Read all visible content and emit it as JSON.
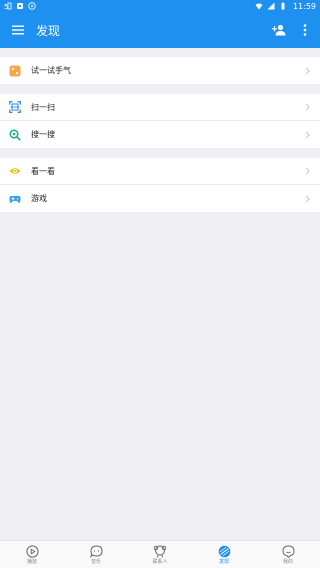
{
  "status_bar": {
    "left_icons": [
      "qq-notification-icon",
      "image-notification-icon",
      "play-notification-icon"
    ],
    "right_icons": [
      "wifi-icon",
      "signal-icon",
      "battery-icon"
    ],
    "time": "11:59"
  },
  "app_bar": {
    "title": "发现",
    "actions": [
      "add-contact-icon",
      "more-vertical-icon"
    ]
  },
  "groups": [
    {
      "items": [
        {
          "label": "试一试手气",
          "icon": "dice-icon",
          "color": "#f4a84a"
        }
      ]
    },
    {
      "items": [
        {
          "label": "扫一扫",
          "icon": "scan-icon",
          "color": "#3a8ee6"
        },
        {
          "label": "搜一搜",
          "icon": "search-icon",
          "color": "#19b28a"
        }
      ]
    },
    {
      "items": [
        {
          "label": "看一看",
          "icon": "eye-icon",
          "color": "#f2c200"
        },
        {
          "label": "游戏",
          "icon": "gamepad-icon",
          "color": "#3aa0e6"
        }
      ]
    }
  ],
  "bottom_nav": [
    {
      "label": "播放",
      "icon": "play-circle-icon",
      "active": false
    },
    {
      "label": "音乐",
      "icon": "chat-bubble-icon",
      "active": false
    },
    {
      "label": "联系人",
      "icon": "contacts-icon",
      "active": false
    },
    {
      "label": "发现",
      "icon": "discover-icon",
      "active": true
    },
    {
      "label": "我的",
      "icon": "profile-icon",
      "active": false
    }
  ],
  "colors": {
    "primary": "#1e90f0",
    "background": "#efeff4"
  }
}
